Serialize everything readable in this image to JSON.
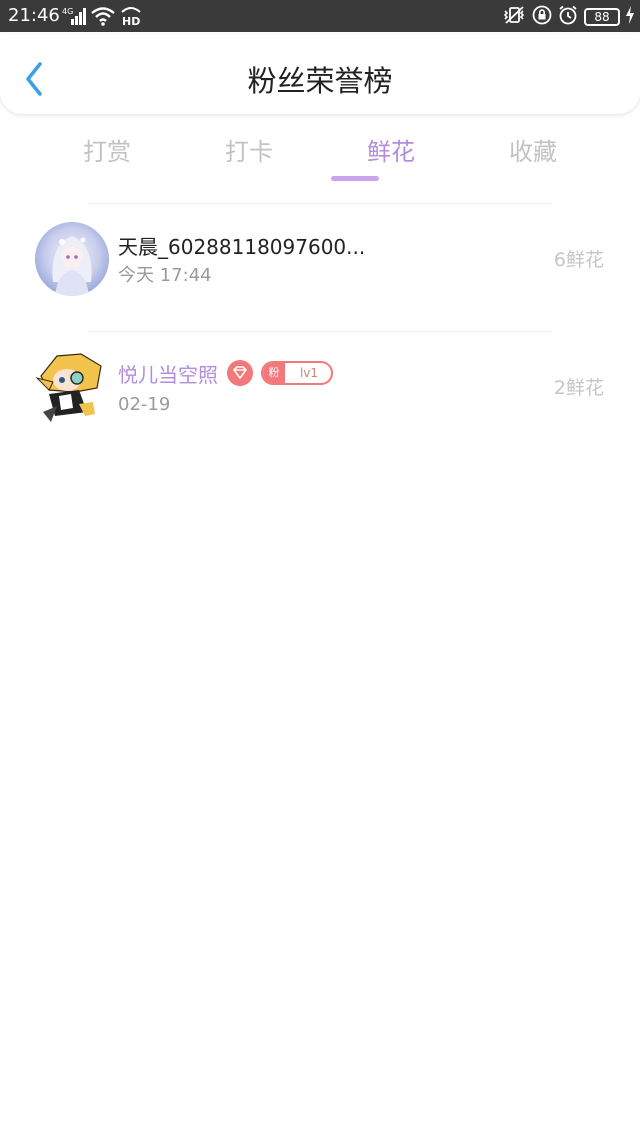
{
  "status_bar": {
    "time": "21:46",
    "network": "4G",
    "hd": "HD",
    "battery": "88"
  },
  "header": {
    "title": "粉丝荣誉榜"
  },
  "tabs": [
    {
      "label": "打赏",
      "active": false
    },
    {
      "label": "打卡",
      "active": false
    },
    {
      "label": "鲜花",
      "active": true
    },
    {
      "label": "收藏",
      "active": false
    }
  ],
  "list": [
    {
      "name": "天晨_60288118097600...",
      "date": "今天 17:44",
      "count": "6鲜花"
    },
    {
      "name": "悦儿当空照",
      "date": "02-19",
      "count": "2鲜花",
      "badge_fen": "粉",
      "badge_level": "lv1"
    }
  ],
  "colors": {
    "accent": "#b38cdc",
    "badge": "#f2787a",
    "back_arrow": "#3a9ee8"
  }
}
